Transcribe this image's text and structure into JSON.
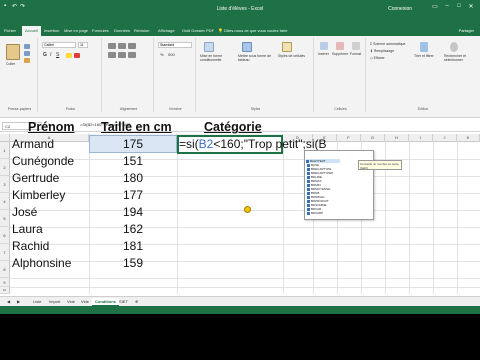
{
  "window": {
    "title": "Liste d'élèves - Excel",
    "user": "Connexion"
  },
  "ribbon_tabs": [
    "Fichier",
    "Accueil",
    "Insertion",
    "Mise en page",
    "Formules",
    "Données",
    "Révision",
    "Affichage",
    "Outil Dossier PDF"
  ],
  "active_tab": "Accueil",
  "tell_me": "Dites-nous ce que vous voulez faire",
  "share": "Partager",
  "ribbon_groups": [
    "Presse-papiers",
    "Police",
    "Alignement",
    "Nombre",
    "Styles",
    "Cellules",
    "Édition"
  ],
  "ribbon_buttons": {
    "paste": "Coller",
    "conditional_formatting": "Mise en forme conditionnelle",
    "format_table": "Mettre sous forme de tableau",
    "cell_styles": "Styles de cellules",
    "insert": "Insérer",
    "delete": "Supprimer",
    "format": "Format",
    "autosum": "Somme automatique",
    "fill": "Remplissage",
    "clear": "Effacer",
    "sort_filter": "Trier et filtrer",
    "find_select": "Rechercher et sélectionner",
    "font_name": "Calibri",
    "font_size": "11",
    "number_format": "Standard"
  },
  "formula_bar": {
    "name_box": "C2",
    "fx": "fx",
    "content": "=SI(B2<160;\"Trop petit\";si(B"
  },
  "columns": [
    "A",
    "B",
    "C",
    "D",
    "E",
    "F",
    "G",
    "H",
    "I",
    "J",
    "K"
  ],
  "rows": [
    "1",
    "2",
    "3",
    "4",
    "5",
    "6",
    "7",
    "8",
    "9",
    "10",
    "11",
    "12",
    "13"
  ],
  "table": {
    "headers": [
      "Prénom",
      "Taille en cm",
      "Catégorie"
    ],
    "names": [
      "Armand",
      "Cunégonde",
      "Gertrude",
      "Kimberley",
      "José",
      "Laura",
      "Rachid",
      "Alphonsine"
    ],
    "heights": [
      "175",
      "151",
      "180",
      "177",
      "194",
      "162",
      "181",
      "159"
    ],
    "formula_prefix": "=si(",
    "formula_ref": "B2",
    "formula_suffix": "<160;\"Trop petit\";si(B"
  },
  "autocomplete": {
    "tooltip": "SI(test_logique; [valeur_si_vrai]; [valeur_si_faux])",
    "side_tip": "Convertit un nombre en texte (baht)",
    "items": [
      "BAHTTEXT",
      "BASE",
      "BDECARTYPE",
      "BDECARTYPEP",
      "BDLIRE",
      "BDMAX",
      "BDMIN",
      "BDMOYENNE",
      "BDNB",
      "BDNBVAL",
      "BDPRODUIT",
      "BDSOMME",
      "BDVAR",
      "BDVARP"
    ]
  },
  "sheet_tabs": [
    "Liste",
    "Import",
    "Vide",
    "Vide",
    "Conditions",
    "SIET"
  ],
  "active_sheet": "Conditions"
}
